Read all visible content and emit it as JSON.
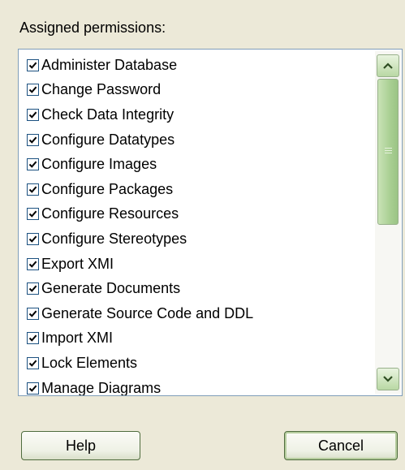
{
  "header": {
    "title": "Assigned permissions:"
  },
  "permissions": [
    {
      "label": "Administer Database",
      "checked": true
    },
    {
      "label": "Change Password",
      "checked": true
    },
    {
      "label": "Check Data Integrity",
      "checked": true
    },
    {
      "label": "Configure Datatypes",
      "checked": true
    },
    {
      "label": "Configure Images",
      "checked": true
    },
    {
      "label": "Configure Packages",
      "checked": true
    },
    {
      "label": "Configure Resources",
      "checked": true
    },
    {
      "label": "Configure Stereotypes",
      "checked": true
    },
    {
      "label": "Export XMI",
      "checked": true
    },
    {
      "label": "Generate Documents",
      "checked": true
    },
    {
      "label": "Generate Source Code and DDL",
      "checked": true
    },
    {
      "label": "Import XMI",
      "checked": true
    },
    {
      "label": "Lock Elements",
      "checked": true
    },
    {
      "label": "Manage Diagrams",
      "checked": true
    }
  ],
  "scrollbar": {
    "up_icon": "arrow-up-icon",
    "down_icon": "arrow-down-icon"
  },
  "buttons": {
    "help_label": "Help",
    "cancel_label": "Cancel"
  },
  "colors": {
    "accent": "#1c5180",
    "scrollbar": "#a9cf93",
    "background": "#ece9d8"
  }
}
